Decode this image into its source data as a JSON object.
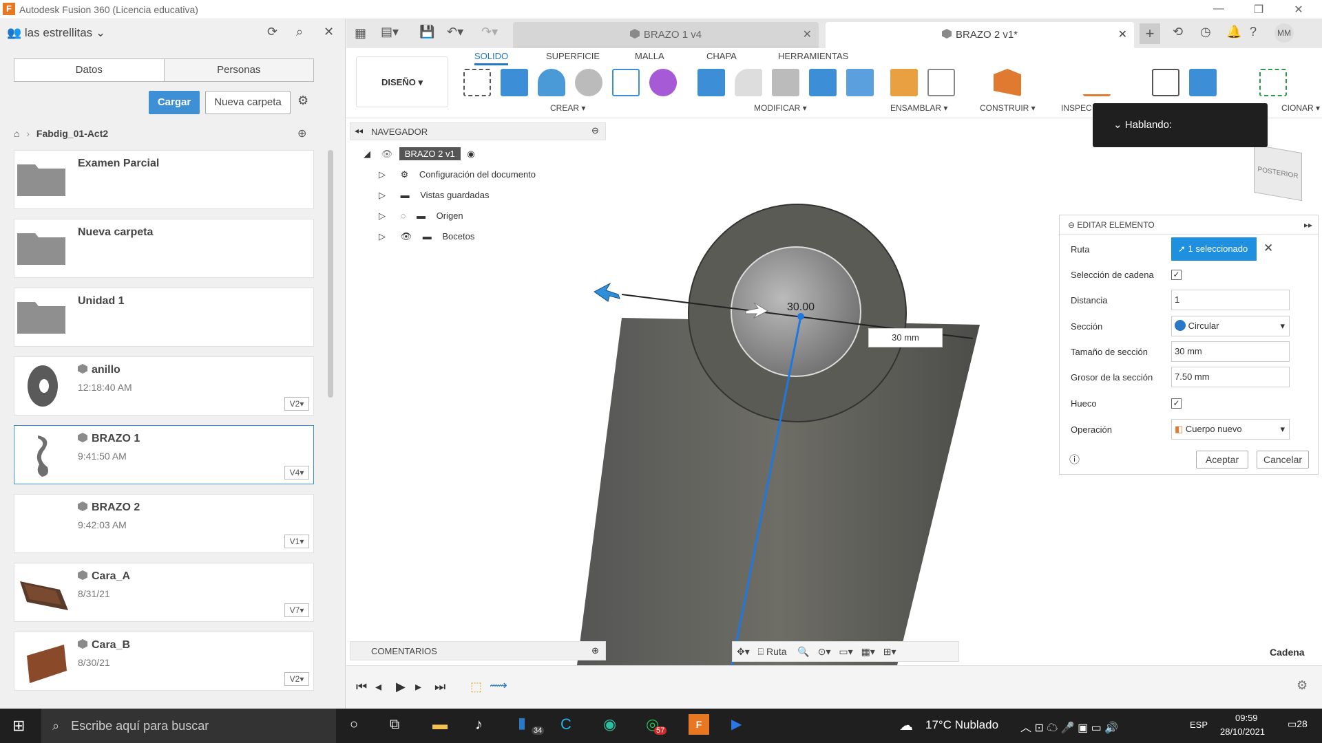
{
  "window": {
    "title": "Autodesk Fusion 360 (Licencia educativa)"
  },
  "left_panel": {
    "project": "las estrellitas",
    "tabs": [
      "Datos",
      "Personas"
    ],
    "upload_label": "Cargar",
    "new_folder_label": "Nueva carpeta",
    "breadcrumb": "Fabdig_01-Act2",
    "folders": [
      {
        "name": "Examen Parcial"
      },
      {
        "name": "Nueva carpeta"
      },
      {
        "name": "Unidad 1"
      }
    ],
    "files": [
      {
        "name": "anillo",
        "sub": "12:18:40 AM",
        "version": "V2"
      },
      {
        "name": "BRAZO 1",
        "sub": "9:41:50 AM",
        "version": "V4"
      },
      {
        "name": "BRAZO 2",
        "sub": "9:42:03 AM",
        "version": "V1"
      },
      {
        "name": "Cara_A",
        "sub": "8/31/21",
        "version": "V7"
      },
      {
        "name": "Cara_B",
        "sub": "8/30/21",
        "version": "V2"
      }
    ]
  },
  "doc_tabs": [
    {
      "label": "BRAZO 1 v4"
    },
    {
      "label": "BRAZO 2 v1*"
    }
  ],
  "ribbon": {
    "workspace": "DISEÑO",
    "tabs": [
      "SOLIDO",
      "SUPERFICIE",
      "MALLA",
      "CHAPA",
      "HERRAMIENTAS"
    ],
    "groups": [
      "CREAR",
      "MODIFICAR",
      "ENSAMBLAR",
      "CONSTRUIR",
      "INSPEC",
      "CIONAR"
    ]
  },
  "navigator": {
    "title": "NAVEGADOR",
    "root": "BRAZO 2 v1",
    "items": [
      "Configuración del documento",
      "Vistas guardadas",
      "Origen",
      "Bocetos"
    ]
  },
  "comments_label": "COMENTARIOS",
  "speaking": "Hablando:",
  "viewcube_label": "POSTERIOR",
  "viewport": {
    "dimension_label": "30.00",
    "dimension_input": "30 mm"
  },
  "edit_dialog": {
    "title": "EDITAR ELEMENTO",
    "rows": {
      "ruta": "Ruta",
      "ruta_value": "1 seleccionado",
      "cadena": "Selección de cadena",
      "distancia": "Distancia",
      "distancia_value": "1",
      "seccion": "Sección",
      "seccion_value": "Circular",
      "tamano": "Tamaño de sección",
      "tamano_value": "30 mm",
      "grosor": "Grosor de la sección",
      "grosor_value": "7.50 mm",
      "hueco": "Hueco",
      "operacion": "Operación",
      "operacion_value": "Cuerpo nuevo"
    },
    "ok": "Aceptar",
    "cancel": "Cancelar"
  },
  "bottom_toolbar": {
    "ruta": "Ruta"
  },
  "status_right": "Cadena",
  "taskbar": {
    "search": "Escribe aquí para buscar",
    "weather": "17°C  Nublado",
    "lang": "ESP",
    "time": "09:59",
    "date": "28/10/2021",
    "notif": "28",
    "badge_34": "34",
    "badge_57": "57"
  },
  "user_initials": "MM"
}
